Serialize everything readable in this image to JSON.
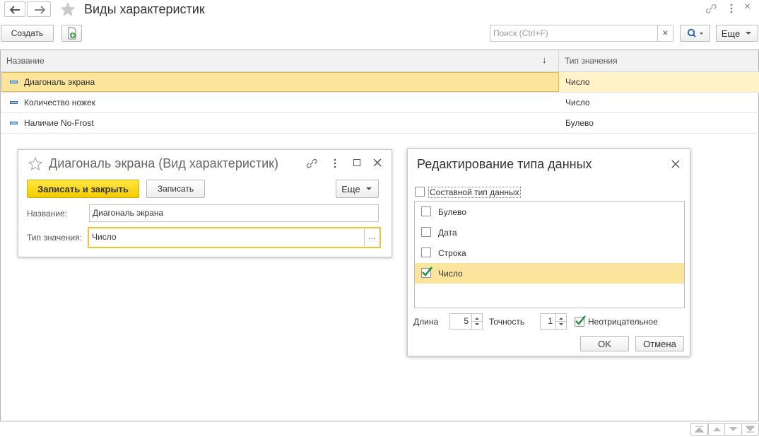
{
  "header": {
    "title": "Виды характеристик",
    "nav_back_icon": "arrow-left-icon",
    "nav_forward_icon": "arrow-right-icon",
    "favorite_icon": "star-icon"
  },
  "toolbar": {
    "create_label": "Создать",
    "search_placeholder": "Поиск (Ctrl+F)",
    "search_clear": "×",
    "more_label": "Еще"
  },
  "table": {
    "columns": [
      "Название",
      "Тип значения"
    ],
    "sort_indicator": "↓",
    "rows": [
      {
        "name": "Диагональ экрана",
        "type": "Число",
        "selected": true
      },
      {
        "name": "Количество ножек",
        "type": "Число",
        "selected": false
      },
      {
        "name": "Наличие No-Frost",
        "type": "Булево",
        "selected": false
      }
    ]
  },
  "form": {
    "title": "Диагональ экрана (Вид характеристик)",
    "save_close_label": "Записать и закрыть",
    "save_label": "Записать",
    "more_label": "Еще",
    "name_label": "Название:",
    "name_value": "Диагональ экрана",
    "type_label": "Тип значения:",
    "type_value": "Число",
    "choose_button": "..."
  },
  "type_dialog": {
    "title": "Редактирование типа данных",
    "composite_label": "Составной тип данных",
    "composite_checked": false,
    "types": [
      {
        "label": "Булево",
        "checked": false
      },
      {
        "label": "Дата",
        "checked": false
      },
      {
        "label": "Строка",
        "checked": false
      },
      {
        "label": "Число",
        "checked": true
      }
    ],
    "length_label": "Длина",
    "length_value": "5",
    "precision_label": "Точность",
    "precision_value": "1",
    "nonnegative_label": "Неотрицательное",
    "nonnegative_checked": true,
    "ok_label": "OK",
    "cancel_label": "Отмена"
  },
  "colors": {
    "accent_yellow": "#f5d400",
    "selection": "#fbe59d",
    "check_green": "#1e8e3e"
  }
}
